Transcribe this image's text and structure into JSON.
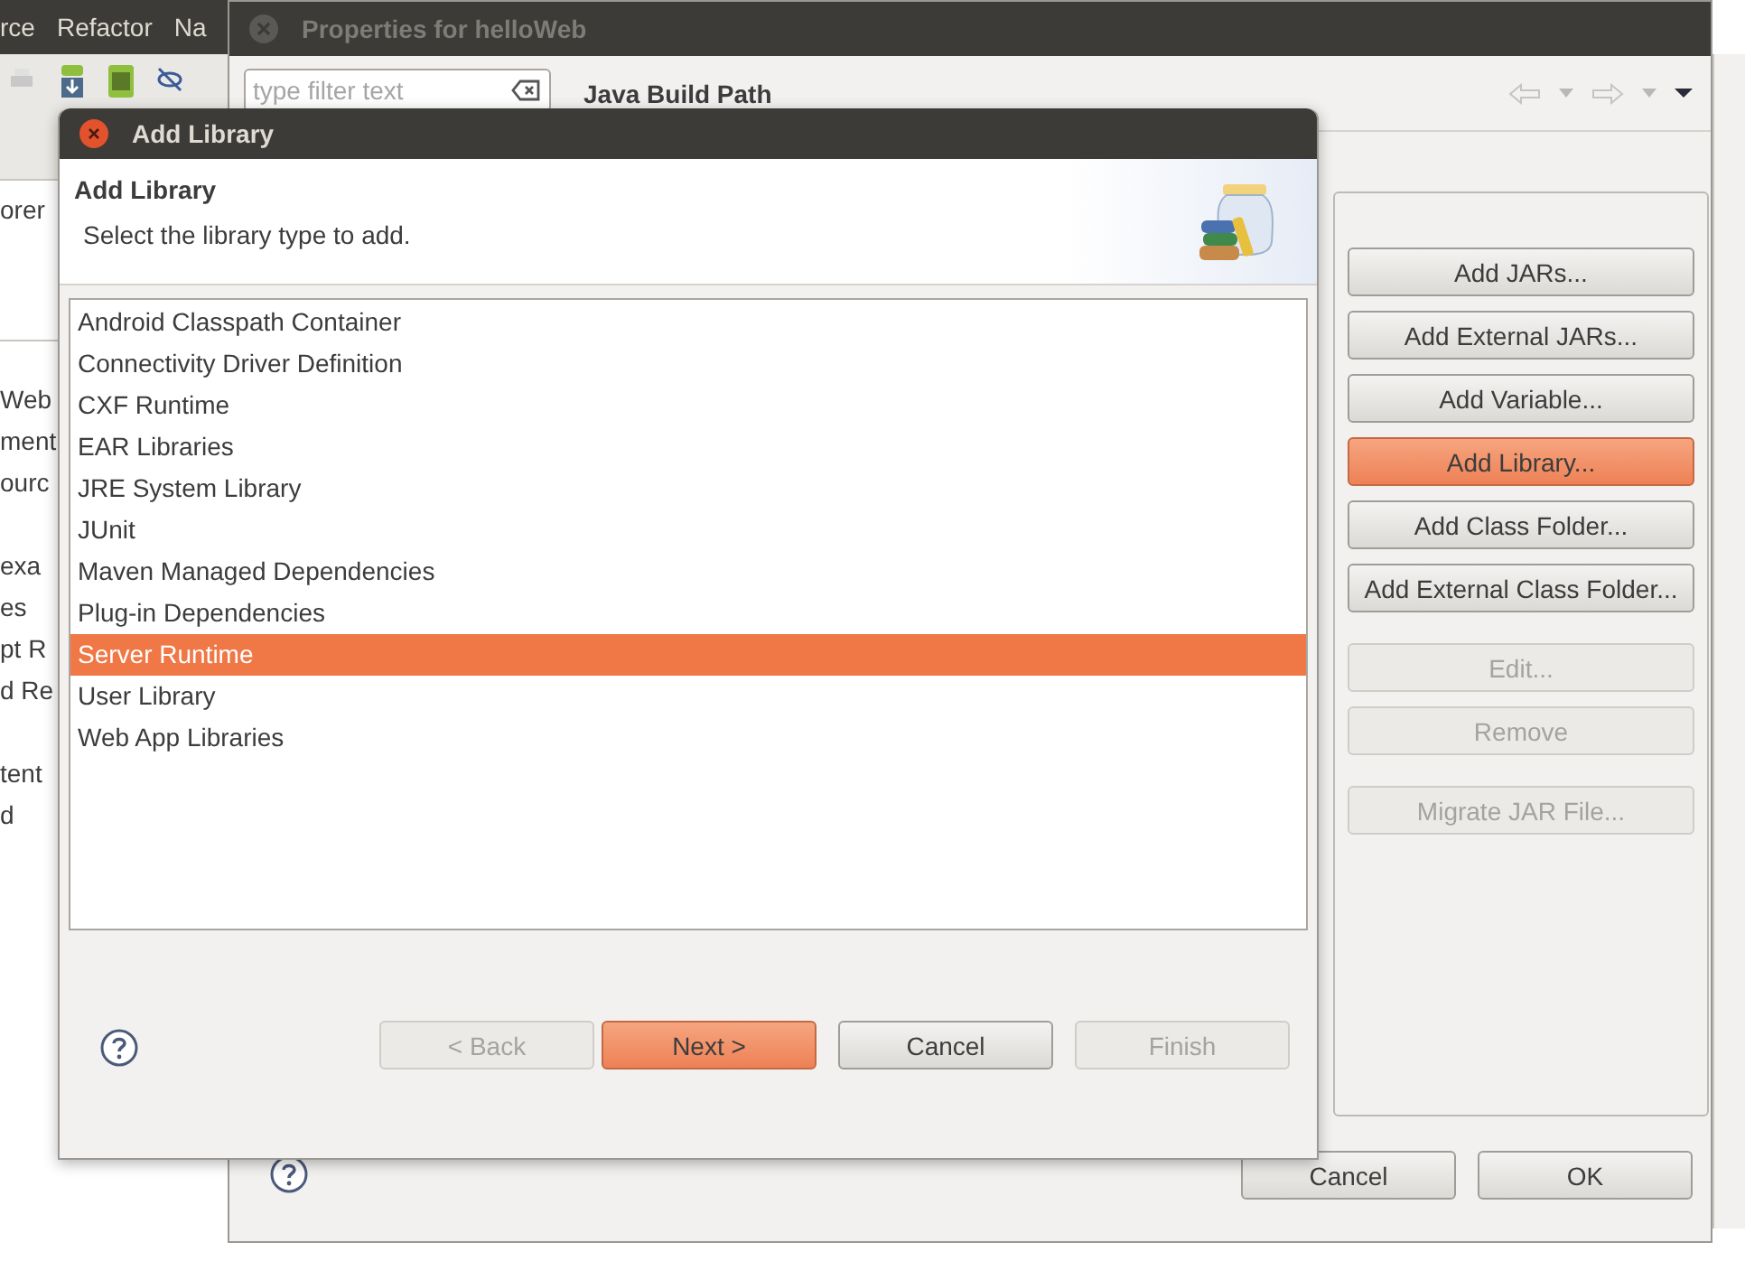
{
  "ide": {
    "menu": [
      "rce",
      "Refactor",
      "Na"
    ],
    "panel_title": "orer",
    "tree_groups": [
      [
        "Web",
        "ment",
        "ourc"
      ],
      [
        "exa",
        "es",
        "pt R",
        "d Re"
      ],
      [
        "tent",
        "d"
      ]
    ]
  },
  "properties_window": {
    "title": "Properties for helloWeb",
    "filter": {
      "placeholder": "type filter text"
    },
    "page_title": "Java Build Path",
    "button_groups": [
      [
        {
          "label": "Add JARs...",
          "disabled": false,
          "highlighted": false
        },
        {
          "label": "Add External JARs...",
          "disabled": false,
          "highlighted": false
        },
        {
          "label": "Add Variable...",
          "disabled": false,
          "highlighted": false
        },
        {
          "label": "Add Library...",
          "disabled": false,
          "highlighted": true
        },
        {
          "label": "Add Class Folder...",
          "disabled": false,
          "highlighted": false
        },
        {
          "label": "Add External Class Folder...",
          "disabled": false,
          "highlighted": false
        }
      ],
      [
        {
          "label": "Edit...",
          "disabled": true,
          "highlighted": false
        },
        {
          "label": "Remove",
          "disabled": true,
          "highlighted": false
        }
      ],
      [
        {
          "label": "Migrate JAR File...",
          "disabled": true,
          "highlighted": false
        }
      ]
    ],
    "footer_buttons": [
      {
        "label": "Cancel",
        "disabled": false,
        "highlighted": false
      },
      {
        "label": "OK",
        "disabled": false,
        "highlighted": false
      }
    ]
  },
  "dialog": {
    "title": "Add Library",
    "heading": "Add Library",
    "description": "Select the library type to add.",
    "library_types": [
      {
        "label": "Android Classpath Container",
        "selected": false
      },
      {
        "label": "Connectivity Driver Definition",
        "selected": false
      },
      {
        "label": "CXF Runtime",
        "selected": false
      },
      {
        "label": "EAR Libraries",
        "selected": false
      },
      {
        "label": "JRE System Library",
        "selected": false
      },
      {
        "label": "JUnit",
        "selected": false
      },
      {
        "label": "Maven Managed Dependencies",
        "selected": false
      },
      {
        "label": "Plug-in Dependencies",
        "selected": false
      },
      {
        "label": "Server Runtime",
        "selected": true
      },
      {
        "label": "User Library",
        "selected": false
      },
      {
        "label": "Web App Libraries",
        "selected": false
      }
    ],
    "nav_buttons": [
      {
        "label": "< Back",
        "disabled": true,
        "highlighted": false
      },
      {
        "label": "Next >",
        "disabled": false,
        "highlighted": true
      }
    ],
    "action_buttons": [
      {
        "label": "Cancel",
        "disabled": false,
        "highlighted": false
      },
      {
        "label": "Finish",
        "disabled": true,
        "highlighted": false
      }
    ]
  }
}
